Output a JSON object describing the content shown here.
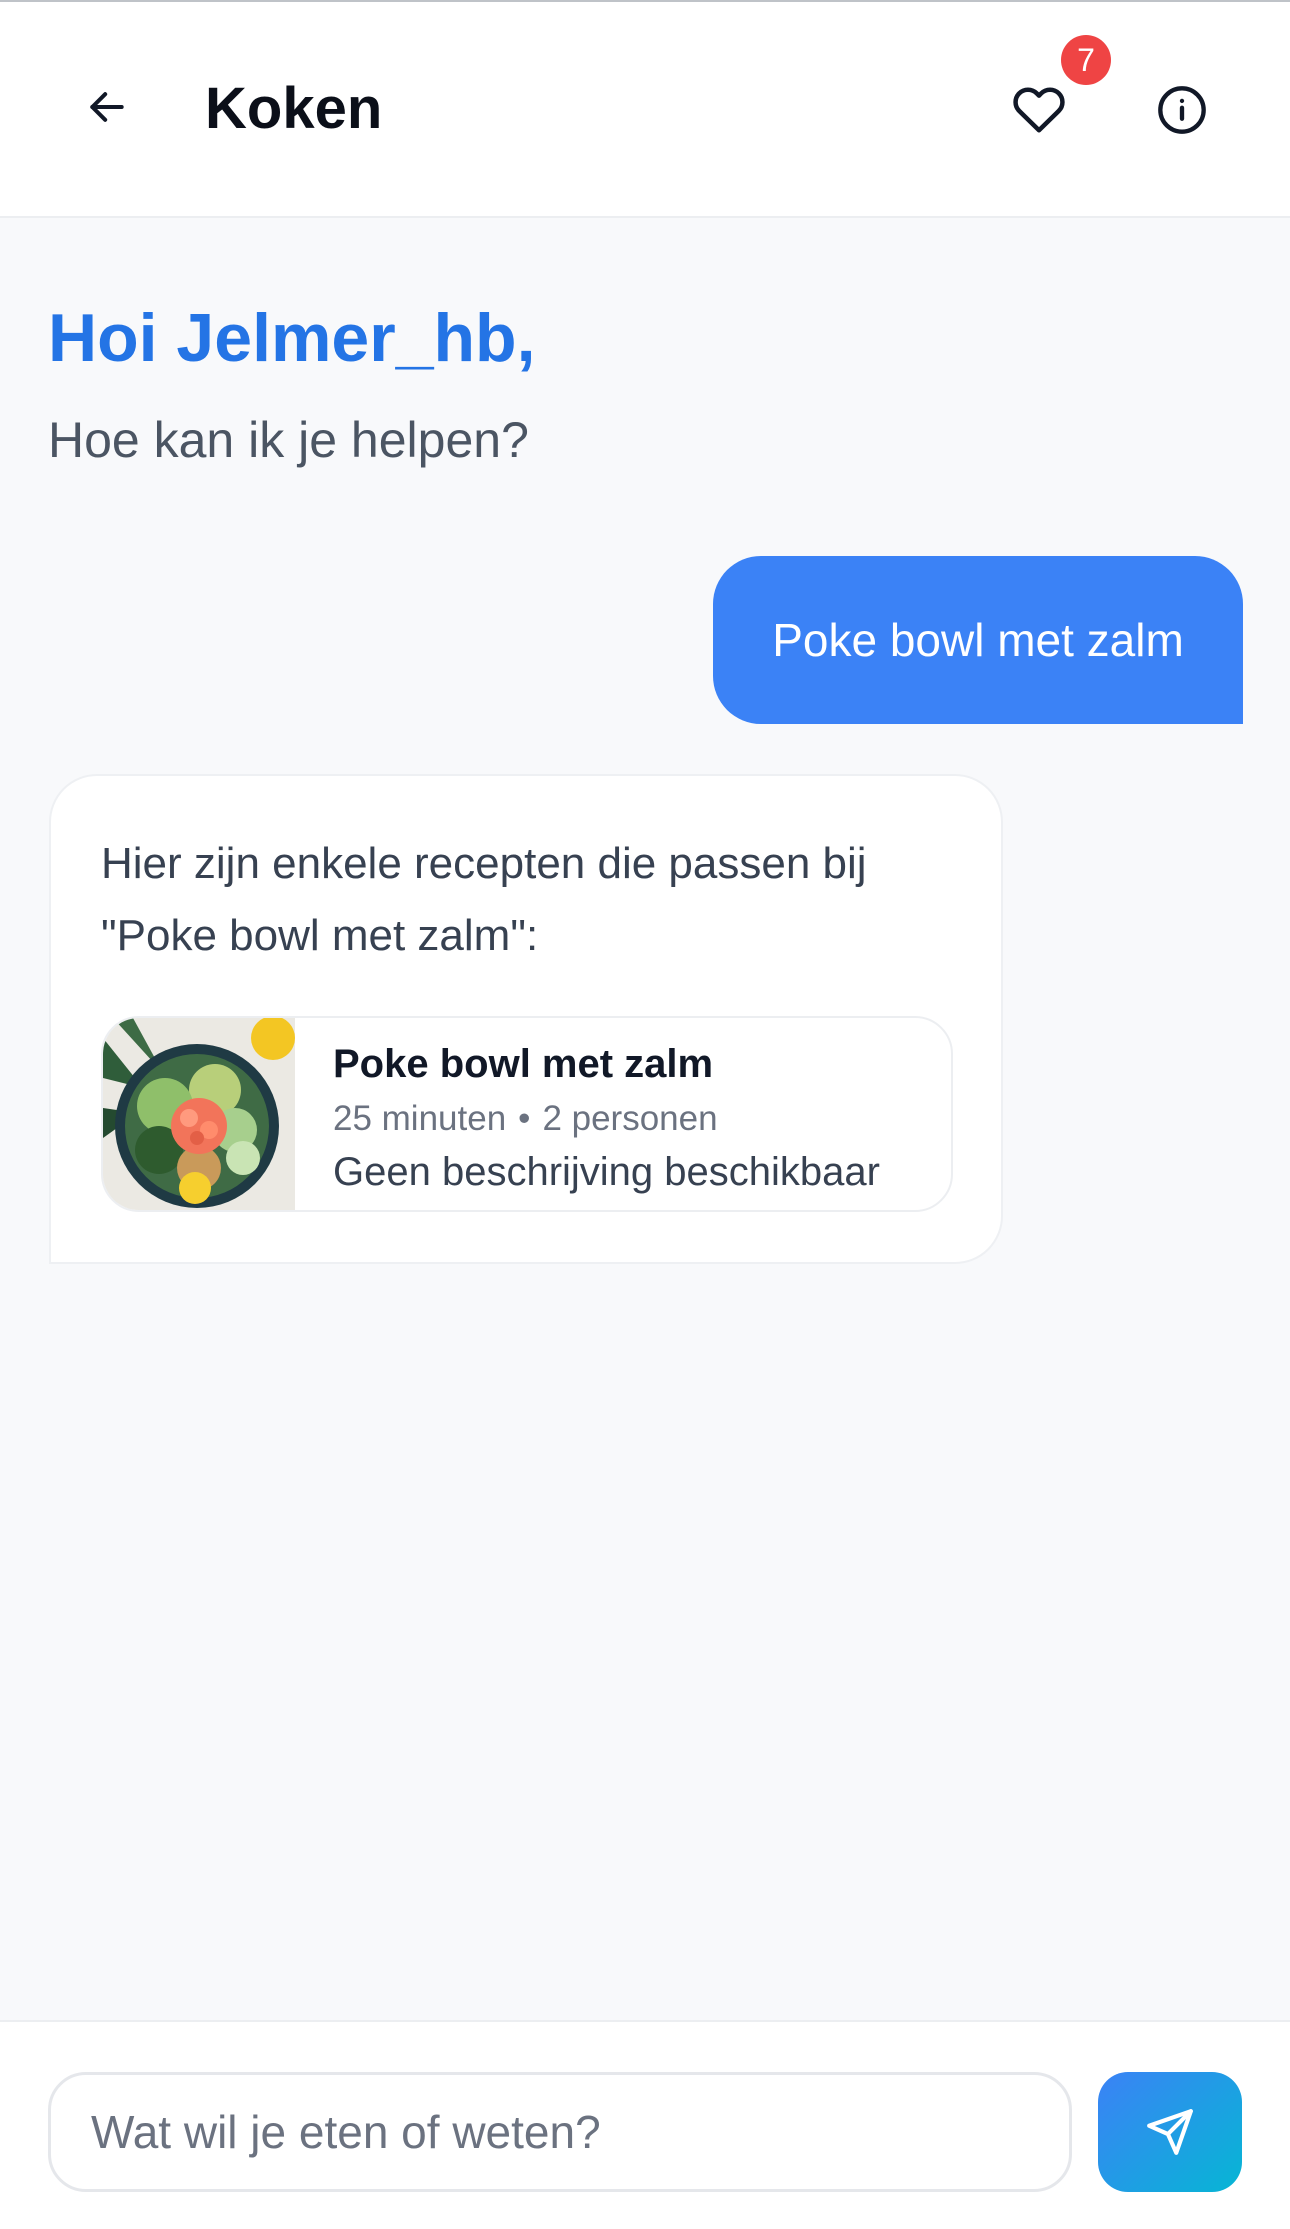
{
  "header": {
    "title": "Koken",
    "favorites_count": "7",
    "back_icon": "arrow-left-icon",
    "favorites_icon": "heart-icon",
    "info_icon": "info-circle-icon"
  },
  "greeting": {
    "title": "Hoi Jelmer_hb,",
    "subtitle": "Hoe kan ik je helpen?"
  },
  "messages": {
    "user": "Poke bowl met zalm",
    "bot_intro": "Hier zijn enkele recepten die passen bij \"Poke bowl met zalm\":",
    "recipe": {
      "name": "Poke bowl met zalm",
      "time": "25 minuten",
      "separator": "•",
      "servings": "2 personen",
      "description": "Geen beschrijving beschikbaar"
    }
  },
  "composer": {
    "placeholder": "Wat wil je eten of weten?",
    "send_icon": "send-icon"
  },
  "colors": {
    "accent": "#3b82f6",
    "greeting": "#2474e5",
    "badge": "#ef4444"
  }
}
